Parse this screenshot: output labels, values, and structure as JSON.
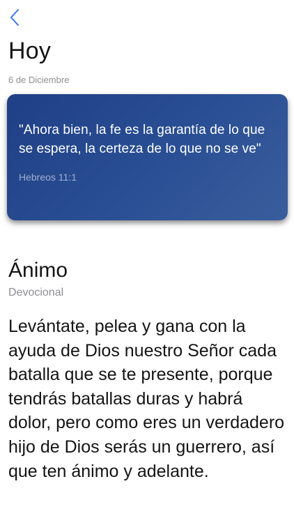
{
  "header": {
    "title": "Hoy",
    "date": "6 de Diciembre"
  },
  "verse": {
    "text": "\"Ahora bien, la fe es la garantía de lo que se espera, la certeza de lo que no se ve\"",
    "reference": "Hebreos 11:1"
  },
  "devotional": {
    "title": "Ánimo",
    "type": "Devocional",
    "body": "Levántate, pelea y gana con la ayuda de Dios nuestro Señor cada batalla que se te presente, porque tendrás batallas duras y habrá dolor, pero como eres un verdadero hijo de Dios serás un guerrero, así que ten ánimo y adelante."
  },
  "colors": {
    "accent": "#3478f6",
    "card_gradient_start": "#1f3f86",
    "card_gradient_end": "#3a5d9c"
  },
  "icons": {
    "back": "chevron-left-icon"
  }
}
